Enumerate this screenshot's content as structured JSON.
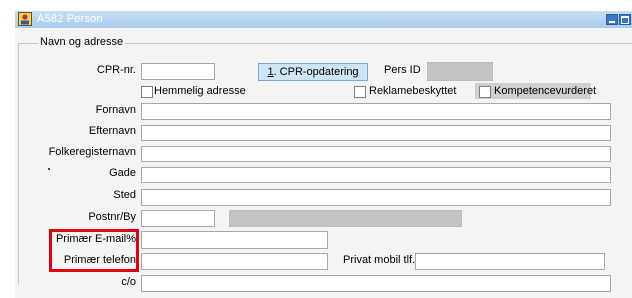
{
  "window": {
    "title": "A582 Person"
  },
  "group": {
    "title": "Navn og adresse"
  },
  "cpr": {
    "label": "CPR-nr.",
    "value": "",
    "button_mnemonic": "1",
    "button_rest": ". CPR-opdatering",
    "pers_id_label": "Pers ID",
    "pers_id_value": ""
  },
  "checkboxes": {
    "hemmelig": {
      "label": "Hemmelig adresse",
      "checked": false
    },
    "reklame": {
      "label": "Reklamebeskyttet",
      "checked": false
    },
    "kompetence": {
      "label": "Kompetencevurderet",
      "checked": false
    }
  },
  "fields": {
    "fornavn": {
      "label": "Fornavn",
      "value": ""
    },
    "efternavn": {
      "label": "Efternavn",
      "value": ""
    },
    "folkeregisternavn": {
      "label": "Folkeregisternavn",
      "value": ""
    },
    "gade": {
      "label": "Gade",
      "value": ""
    },
    "sted": {
      "label": "Sted",
      "value": ""
    },
    "postnr": {
      "label": "Postnr/By",
      "value": "",
      "city": ""
    },
    "email": {
      "label": "Primær  E-mail%",
      "value": ""
    },
    "telefon": {
      "label": "Primær  telefon",
      "value": ""
    },
    "mobil": {
      "label": "Privat mobil tlf.",
      "value": ""
    },
    "co": {
      "label": "c/o",
      "value": ""
    }
  },
  "colors": {
    "highlight": "#e0000f",
    "titlebar": "#a9cbec"
  }
}
